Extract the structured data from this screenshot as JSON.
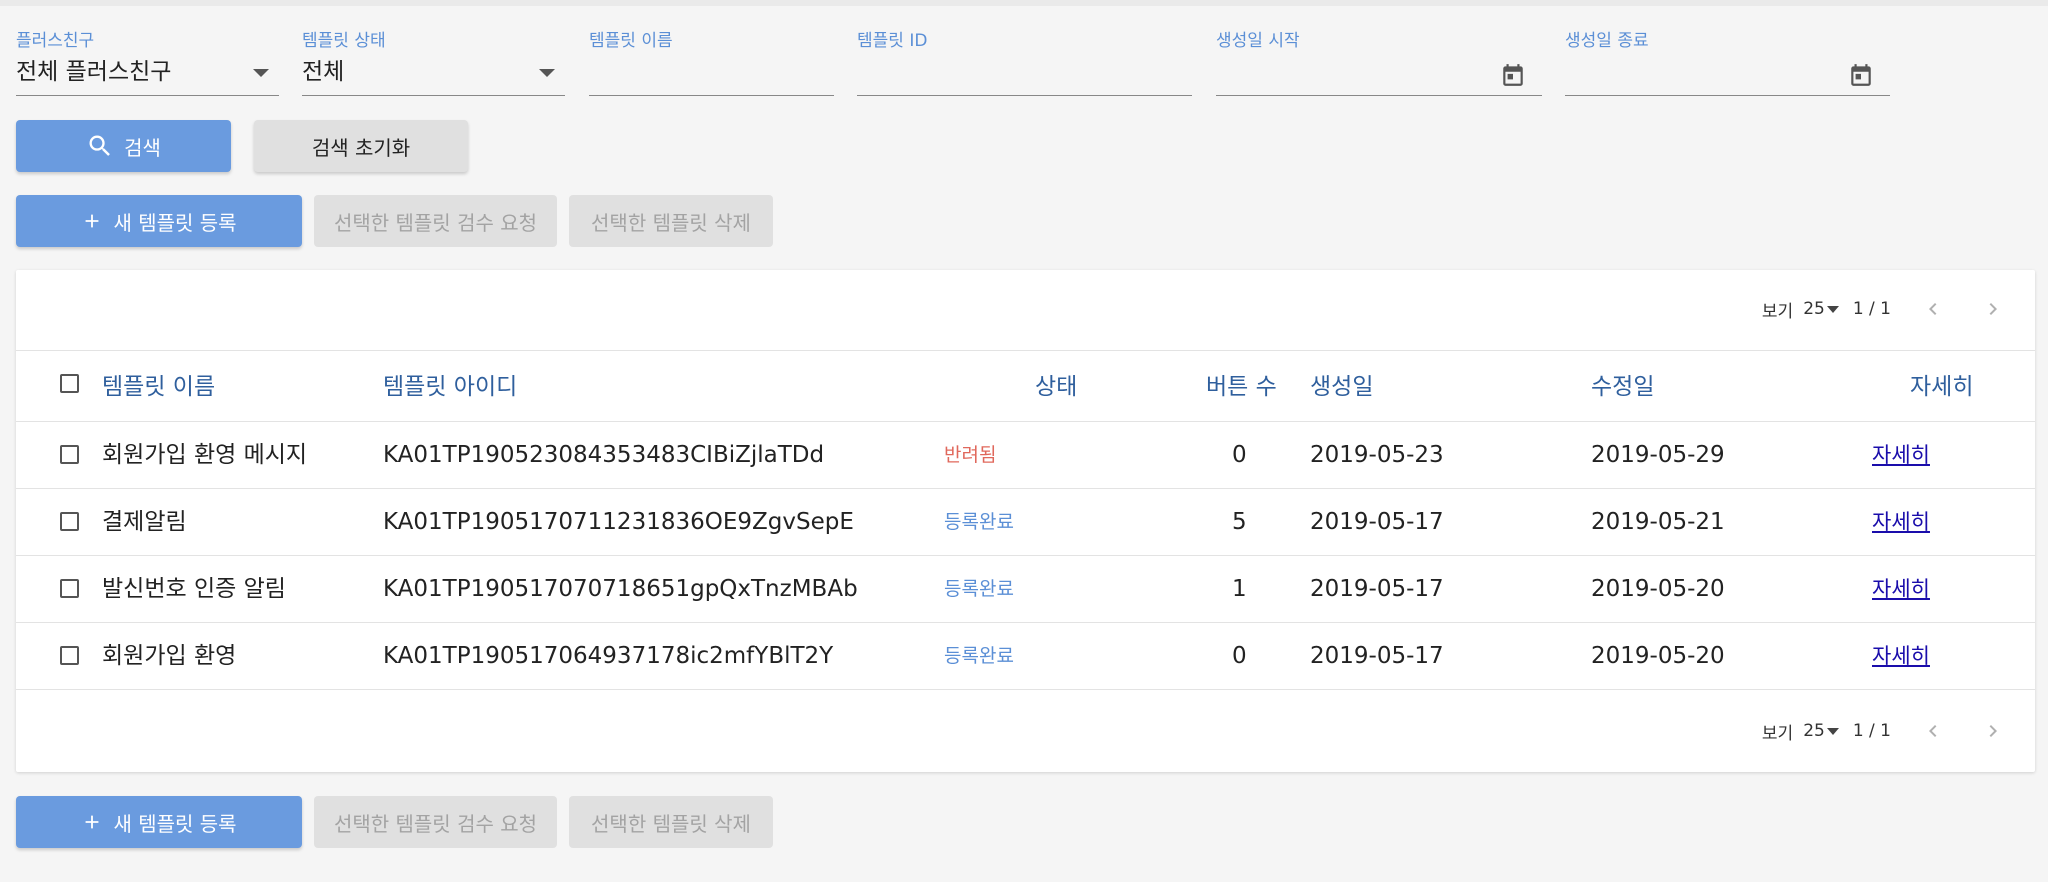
{
  "filters": {
    "plus_friend": {
      "label": "플러스친구",
      "value": "전체 플러스친구"
    },
    "template_status": {
      "label": "템플릿 상태",
      "value": "전체"
    },
    "template_name": {
      "label": "템플릿 이름",
      "value": ""
    },
    "template_id": {
      "label": "템플릿 ID",
      "value": ""
    },
    "created_start": {
      "label": "생성일 시작",
      "value": ""
    },
    "created_end": {
      "label": "생성일 종료",
      "value": ""
    }
  },
  "search": {
    "search_label": "검색",
    "reset_label": "검색 초기화"
  },
  "actions": {
    "new_template": "새 템플릿 등록",
    "request_review": "선택한 템플릿 검수 요청",
    "delete_selected": "선택한 템플릿 삭제"
  },
  "pagination": {
    "view_label": "보기",
    "per_page": "25",
    "range": "1 / 1"
  },
  "table": {
    "headers": {
      "name": "템플릿 이름",
      "id": "템플릿 아이디",
      "status": "상태",
      "buttons": "버튼 수",
      "created": "생성일",
      "modified": "수정일",
      "detail": "자세히"
    },
    "rows": [
      {
        "name": "회원가입 환영 메시지",
        "id": "KA01TP190523084353483CIBiZjlaTDd",
        "status": "반려됨",
        "buttons": "0",
        "created": "2019-05-23",
        "modified": "2019-05-29",
        "detail": "자세히"
      },
      {
        "name": "결제알림",
        "id": "KA01TP190517071123183 6OE9ZgvSepE",
        "status": "등록완료",
        "buttons": "5",
        "created": "2019-05-17",
        "modified": "2019-05-21",
        "detail": "자세히"
      },
      {
        "name": "발신번호 인증 알림",
        "id": "KA01TP190517070718651gpQxTnzMBAb",
        "status": "등록완료",
        "buttons": "1",
        "created": "2019-05-17",
        "modified": "2019-05-20",
        "detail": "자세히"
      },
      {
        "name": "회원가입 환영",
        "id": "KA01TP190517064937178ic2mfYBlT2Y",
        "status": "등록완료",
        "buttons": "0",
        "created": "2019-05-17",
        "modified": "2019-05-20",
        "detail": "자세히"
      }
    ]
  },
  "colors": {
    "accent": "#6a9bdf",
    "label_blue": "#5b8fd6",
    "header_blue": "#2f5f9d",
    "status_rejected": "#e0685c",
    "status_registered": "#5b8fd6"
  }
}
